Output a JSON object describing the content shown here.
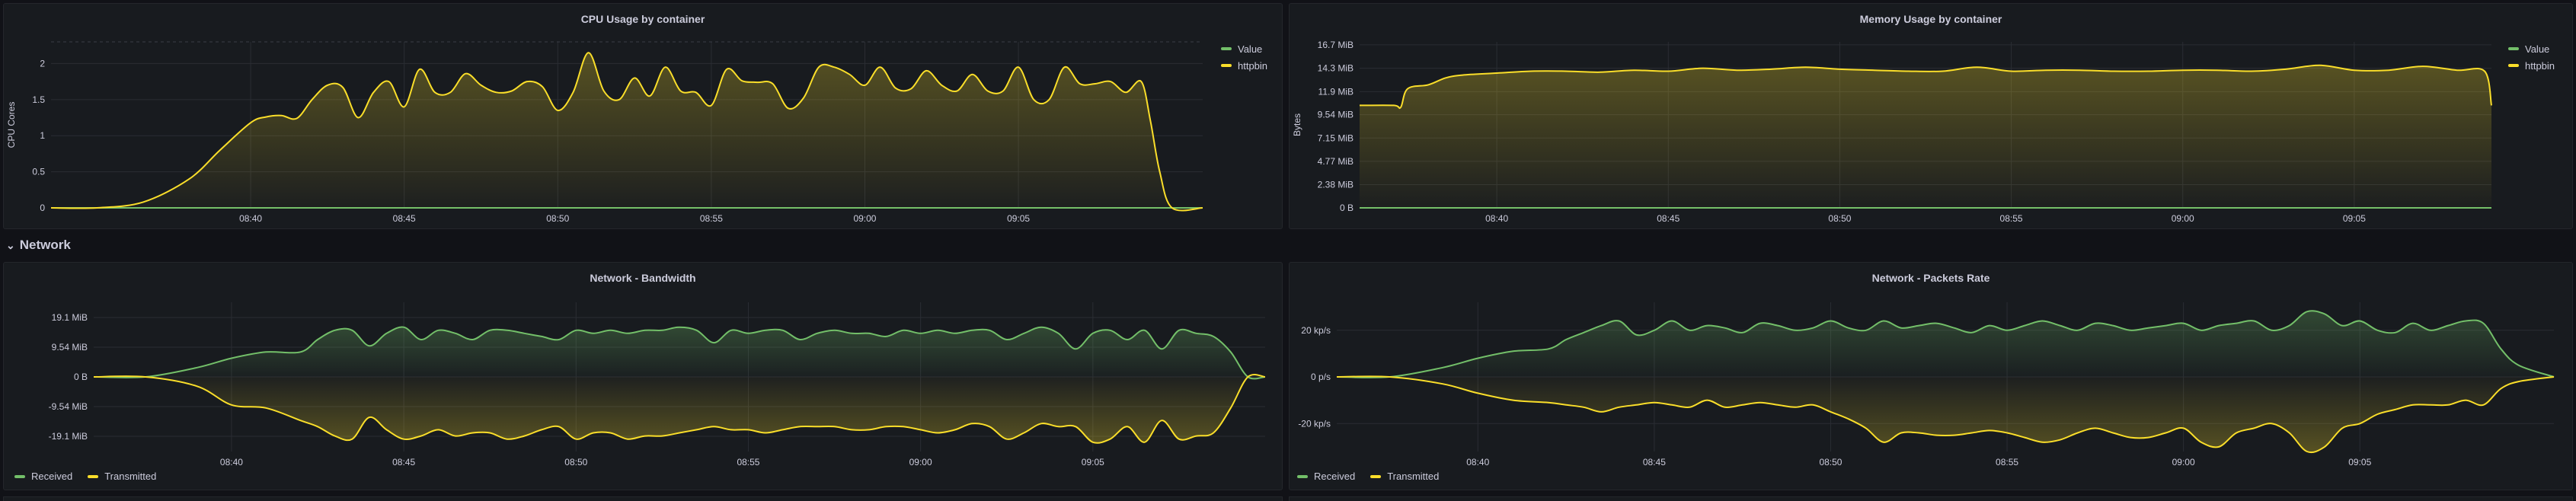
{
  "colors": {
    "background": "#111217",
    "panel": "#181b1f",
    "green": "#73bf69",
    "yellow": "#fade2a",
    "grid": "#2a2d33",
    "axis_text": "#ccccdc"
  },
  "row": {
    "label": "Network",
    "icon": "chevron-down-icon"
  },
  "panels": {
    "cpu": {
      "title": "CPU Usage by container",
      "legend": [
        "Value",
        "httpbin"
      ],
      "chart_data": {
        "type": "area",
        "title": "CPU Usage by container",
        "ylabel": "CPU Cores",
        "xlabel": "",
        "x_ticks": [
          "08:40",
          "08:45",
          "08:50",
          "08:55",
          "09:00",
          "09:05"
        ],
        "y_ticks": [
          "0",
          "0.5",
          "1",
          "1.5",
          "2"
        ],
        "ylim": [
          0,
          2.3
        ],
        "x_minutes_range": [
          -6.5,
          31
        ],
        "series": [
          {
            "name": "Value",
            "color": "#73bf69",
            "x": [
              -6.5,
              31
            ],
            "values": [
              0,
              0
            ]
          },
          {
            "name": "httpbin",
            "color": "#fade2a",
            "x": [
              -6.5,
              -5,
              -3.5,
              -2,
              -1,
              0,
              0.5,
              1,
              1.5,
              2,
              2.5,
              3,
              3.5,
              4,
              4.5,
              5,
              5.5,
              6,
              6.5,
              7,
              7.5,
              8,
              8.5,
              9,
              9.5,
              10,
              10.5,
              11,
              11.5,
              12,
              12.5,
              13,
              13.5,
              14,
              14.5,
              15,
              15.5,
              16,
              16.5,
              17,
              17.5,
              18,
              18.5,
              19,
              19.5,
              20,
              20.5,
              21,
              21.5,
              22,
              22.5,
              23,
              23.5,
              24,
              24.5,
              25,
              25.5,
              26,
              26.5,
              27,
              27.5,
              28,
              28.5,
              29,
              29.3,
              29.6,
              30,
              31
            ],
            "values": [
              0,
              0,
              0.08,
              0.4,
              0.8,
              1.18,
              1.26,
              1.28,
              1.24,
              1.5,
              1.7,
              1.67,
              1.25,
              1.6,
              1.75,
              1.4,
              1.92,
              1.6,
              1.6,
              1.86,
              1.7,
              1.6,
              1.62,
              1.75,
              1.68,
              1.35,
              1.6,
              2.15,
              1.62,
              1.5,
              1.8,
              1.55,
              1.95,
              1.62,
              1.6,
              1.42,
              1.92,
              1.76,
              1.74,
              1.72,
              1.38,
              1.52,
              1.95,
              1.95,
              1.85,
              1.7,
              1.95,
              1.66,
              1.65,
              1.9,
              1.7,
              1.62,
              1.85,
              1.62,
              1.62,
              1.95,
              1.5,
              1.5,
              1.95,
              1.72,
              1.72,
              1.75,
              1.6,
              1.75,
              1.2,
              0.5,
              0,
              0
            ]
          }
        ]
      }
    },
    "memory": {
      "title": "Memory Usage by container",
      "legend": [
        "Value",
        "httpbin"
      ],
      "chart_data": {
        "type": "area",
        "title": "Memory Usage by container",
        "ylabel": "Bytes",
        "xlabel": "",
        "x_ticks": [
          "08:40",
          "08:45",
          "08:50",
          "08:55",
          "09:00",
          "09:05"
        ],
        "y_ticks": [
          "0 B",
          "2.38 MiB",
          "4.77 MiB",
          "7.15 MiB",
          "9.54 MiB",
          "11.9 MiB",
          "14.3 MiB",
          "16.7 MiB"
        ],
        "ylim": [
          0,
          17
        ],
        "x_minutes_range": [
          -4,
          29
        ],
        "series": [
          {
            "name": "Value",
            "color": "#73bf69",
            "x": [
              -4,
              29
            ],
            "values": [
              0,
              0
            ]
          },
          {
            "name": "httpbin",
            "color": "#fade2a",
            "x": [
              -4,
              -3,
              -2.8,
              -2.6,
              -2,
              -1.5,
              -1,
              0,
              1,
              2,
              3,
              4,
              5,
              6,
              7,
              8,
              9,
              10,
              11,
              12,
              13,
              14,
              15,
              16,
              17,
              18,
              19,
              20,
              21,
              22,
              23,
              24,
              25,
              26,
              27,
              28,
              28.8,
              29
            ],
            "values": [
              10.5,
              10.5,
              10.3,
              12.2,
              12.6,
              13.3,
              13.6,
              13.8,
              14.0,
              14.0,
              13.9,
              14.1,
              14.0,
              14.3,
              14.1,
              14.2,
              14.4,
              14.2,
              14.1,
              14.0,
              14.0,
              14.4,
              14.0,
              14.1,
              14.1,
              14.0,
              14.0,
              14.1,
              14.1,
              14.0,
              14.2,
              14.6,
              14.1,
              14.1,
              14.5,
              14.1,
              14.0,
              10.5
            ]
          }
        ]
      }
    },
    "bandwidth": {
      "title": "Network - Bandwidth",
      "legend": [
        "Received",
        "Transmitted"
      ],
      "chart_data": {
        "type": "area",
        "title": "Network - Bandwidth",
        "ylabel": "",
        "xlabel": "",
        "x_ticks": [
          "08:40",
          "08:45",
          "08:50",
          "08:55",
          "09:00",
          "09:05"
        ],
        "y_ticks": [
          "19.1 MiB",
          "9.54 MiB",
          "0 B",
          "-9.54 MiB",
          "-19.1 MiB"
        ],
        "ylim": [
          -24,
          24
        ],
        "x_minutes_range": [
          -4,
          30
        ],
        "series": [
          {
            "name": "Received",
            "color": "#73bf69",
            "x": [
              -4,
              -2.5,
              -1,
              0,
              1,
              2,
              2.5,
              3,
              3.5,
              4,
              4.5,
              5,
              5.5,
              6,
              6.5,
              7,
              7.5,
              8,
              8.5,
              9,
              9.5,
              10,
              10.5,
              11,
              11.5,
              12,
              12.5,
              13,
              13.5,
              14,
              14.5,
              15,
              15.5,
              16,
              16.5,
              17,
              17.5,
              18,
              18.5,
              19,
              19.5,
              20,
              20.5,
              21,
              21.5,
              22,
              22.5,
              23,
              23.5,
              24,
              24.5,
              25,
              25.5,
              26,
              26.5,
              27,
              27.5,
              28,
              28.5,
              29,
              29.5,
              30
            ],
            "values": [
              0,
              0,
              3,
              6,
              8,
              8,
              12,
              15,
              15,
              10,
              14,
              16,
              12,
              15,
              14,
              12,
              15,
              15,
              14,
              13,
              12,
              15,
              14,
              15,
              14,
              15,
              15,
              16,
              15,
              11,
              15,
              14,
              15,
              15,
              12,
              14,
              15,
              14,
              14,
              13,
              15,
              14,
              15,
              14,
              15,
              15,
              12,
              14,
              16,
              14,
              9,
              14,
              15,
              12,
              15,
              9,
              15,
              14,
              13,
              8,
              0,
              0
            ]
          },
          {
            "name": "Transmitted",
            "color": "#fade2a",
            "x": [
              -4,
              -2.5,
              -1,
              0,
              1,
              2,
              2.5,
              3,
              3.5,
              4,
              4.5,
              5,
              5.5,
              6,
              6.5,
              7,
              7.5,
              8,
              8.5,
              9,
              9.5,
              10,
              10.5,
              11,
              11.5,
              12,
              12.5,
              13,
              13.5,
              14,
              14.5,
              15,
              15.5,
              16,
              16.5,
              17,
              17.5,
              18,
              18.5,
              19,
              19.5,
              20,
              20.5,
              21,
              21.5,
              22,
              22.5,
              23,
              23.5,
              24,
              24.5,
              25,
              25.5,
              26,
              26.5,
              27,
              27.5,
              28,
              28.5,
              29,
              29.5,
              30
            ],
            "values": [
              0,
              0,
              -3,
              -9,
              -10,
              -14,
              -16,
              -19,
              -20,
              -13,
              -17,
              -20,
              -19,
              -17,
              -19,
              -18,
              -18,
              -20,
              -19,
              -17,
              -16,
              -20,
              -18,
              -18,
              -20,
              -19,
              -19,
              -18,
              -17,
              -16,
              -17,
              -17,
              -18,
              -17,
              -16,
              -16,
              -16,
              -17,
              -17,
              -16,
              -16,
              -17,
              -18,
              -17,
              -15,
              -16,
              -20,
              -18,
              -15,
              -16,
              -16,
              -21,
              -20,
              -16,
              -21,
              -14,
              -20,
              -19,
              -18,
              -10,
              0,
              0
            ]
          }
        ]
      }
    },
    "packets": {
      "title": "Network - Packets Rate",
      "legend": [
        "Received",
        "Transmitted"
      ],
      "chart_data": {
        "type": "area",
        "title": "Network - Packets Rate",
        "ylabel": "",
        "xlabel": "",
        "x_ticks": [
          "08:40",
          "08:45",
          "08:50",
          "08:55",
          "09:00",
          "09:05"
        ],
        "y_ticks": [
          "20 kp/s",
          "0 p/s",
          "-20 kp/s"
        ],
        "ylim": [
          -32,
          32
        ],
        "x_minutes_range": [
          -4,
          30.5
        ],
        "series": [
          {
            "name": "Received",
            "color": "#73bf69",
            "x": [
              -4,
              -2.5,
              -1,
              0,
              1,
              2,
              2.5,
              3,
              3.5,
              4,
              4.5,
              5,
              5.5,
              6,
              6.5,
              7,
              7.5,
              8,
              8.5,
              9,
              9.5,
              10,
              10.5,
              11,
              11.5,
              12,
              12.5,
              13,
              13.5,
              14,
              14.5,
              15,
              15.5,
              16,
              16.5,
              17,
              17.5,
              18,
              18.5,
              19,
              19.5,
              20,
              20.5,
              21,
              21.5,
              22,
              22.5,
              23,
              23.5,
              24,
              24.5,
              25,
              25.5,
              26,
              26.5,
              27,
              27.5,
              28,
              28.5,
              29,
              29.5,
              30.5
            ],
            "values": [
              0,
              0,
              4,
              8,
              11,
              12,
              16,
              19,
              22,
              24,
              18,
              20,
              24,
              20,
              22,
              21,
              19,
              23,
              22,
              20,
              21,
              24,
              21,
              20,
              24,
              21,
              22,
              23,
              21,
              19,
              22,
              20,
              22,
              24,
              22,
              20,
              23,
              22,
              20,
              21,
              22,
              23,
              20,
              22,
              23,
              24,
              20,
              22,
              28,
              27,
              22,
              24,
              20,
              19,
              23,
              20,
              22,
              24,
              23,
              12,
              5,
              0
            ]
          },
          {
            "name": "Transmitted",
            "color": "#fade2a",
            "x": [
              -4,
              -2.5,
              -1,
              0,
              1,
              2,
              2.5,
              3,
              3.5,
              4,
              4.5,
              5,
              5.5,
              6,
              6.5,
              7,
              7.5,
              8,
              8.5,
              9,
              9.5,
              10,
              10.5,
              11,
              11.5,
              12,
              12.5,
              13,
              13.5,
              14,
              14.5,
              15,
              15.5,
              16,
              16.5,
              17,
              17.5,
              18,
              18.5,
              19,
              19.5,
              20,
              20.5,
              21,
              21.5,
              22,
              22.5,
              23,
              23.5,
              24,
              24.5,
              25,
              25.5,
              26,
              26.5,
              27,
              27.5,
              28,
              28.5,
              29,
              29.5,
              30.5
            ],
            "values": [
              0,
              0,
              -3,
              -7,
              -10,
              -11,
              -12,
              -13,
              -15,
              -13,
              -12,
              -11,
              -12,
              -13,
              -10,
              -13,
              -12,
              -11,
              -12,
              -13,
              -12,
              -15,
              -18,
              -22,
              -28,
              -24,
              -24,
              -25,
              -25,
              -24,
              -23,
              -24,
              -26,
              -28,
              -27,
              -24,
              -22,
              -24,
              -26,
              -26,
              -24,
              -22,
              -28,
              -30,
              -24,
              -22,
              -20,
              -24,
              -32,
              -30,
              -22,
              -20,
              -16,
              -14,
              -12,
              -12,
              -12,
              -10,
              -12,
              -5,
              -2,
              0
            ]
          }
        ]
      }
    }
  }
}
